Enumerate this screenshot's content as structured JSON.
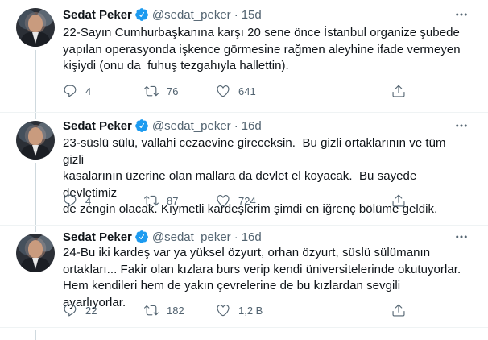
{
  "tweets": [
    {
      "author_name": "Sedat Peker",
      "author_handle": "@sedat_peker",
      "separator": "·",
      "time": "15d",
      "text": "22-Sayın Cumhurbaşkanına karşı 20 sene önce İstanbul organize şubede\nyapılan operasyonda işkence görmesine rağmen aleyhine ifade vermeyen\nkişiydi (onu da  fuhuş tezgahıyla hallettin).",
      "replies": "4",
      "retweets": "76",
      "likes": "641"
    },
    {
      "author_name": "Sedat Peker",
      "author_handle": "@sedat_peker",
      "separator": "·",
      "time": "16d",
      "text": "23-süslü sülü, vallahi cezaevine gireceksin.  Bu gizli ortaklarının ve tüm gizli\nkasalarının üzerine olan mallara da devlet el koyacak.  Bu sayede devletimiz\nde zengin olacak. Kıymetli kardeşlerim şimdi en iğrenç bölüme geldik.",
      "replies": "4",
      "retweets": "87",
      "likes": "724"
    },
    {
      "author_name": "Sedat Peker",
      "author_handle": "@sedat_peker",
      "separator": "·",
      "time": "16d",
      "text": "24-Bu iki kardeş var ya yüksel özyurt, orhan özyurt, süslü sülümanın\nortakları... Fakir olan kızlara burs verip kendi üniversitelerinde okutuyorlar.\nHem kendileri hem de yakın çevrelerine de bu kızlardan sevgili ayarlıyorlar.",
      "replies": "22",
      "retweets": "182",
      "likes": "1,2 B"
    }
  ],
  "colors": {
    "verified": "#1d9bf0",
    "secondary_text": "#536471",
    "thread_line": "#cfd9de",
    "divider": "#eff3f4"
  },
  "icons": {
    "verified": "verified-badge-icon",
    "more": "more-icon",
    "reply": "reply-icon",
    "retweet": "retweet-icon",
    "like": "like-icon",
    "share": "share-icon"
  }
}
